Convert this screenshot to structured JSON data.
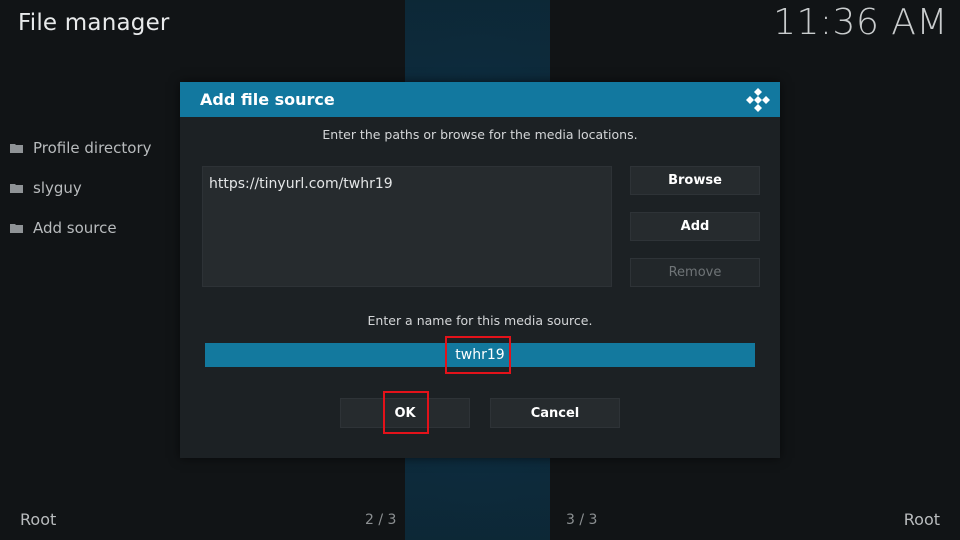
{
  "header": {
    "title": "File manager",
    "clock": "11:36 AM"
  },
  "sidebar": {
    "items": [
      {
        "label": "Profile directory",
        "icon": "folder-icon"
      },
      {
        "label": "slyguy",
        "icon": "folder-icon"
      },
      {
        "label": "Add source",
        "icon": "folder-icon"
      }
    ]
  },
  "dialog": {
    "title": "Add file source",
    "icon": "kodi-logo-icon",
    "paths_label": "Enter the paths or browse for the media locations.",
    "paths": [
      "https://tinyurl.com/twhr19"
    ],
    "browse_label": "Browse",
    "add_label": "Add",
    "remove_label": "Remove",
    "name_label": "Enter a name for this media source.",
    "name_value": "twhr19",
    "ok_label": "OK",
    "cancel_label": "Cancel"
  },
  "footer": {
    "left_path": "Root",
    "left_page": "2 / 3",
    "right_page": "3 / 3",
    "right_path": "Root"
  },
  "colors": {
    "accent": "#12789f",
    "highlight": "#e3121a",
    "dialog_bg": "#1c2124"
  }
}
